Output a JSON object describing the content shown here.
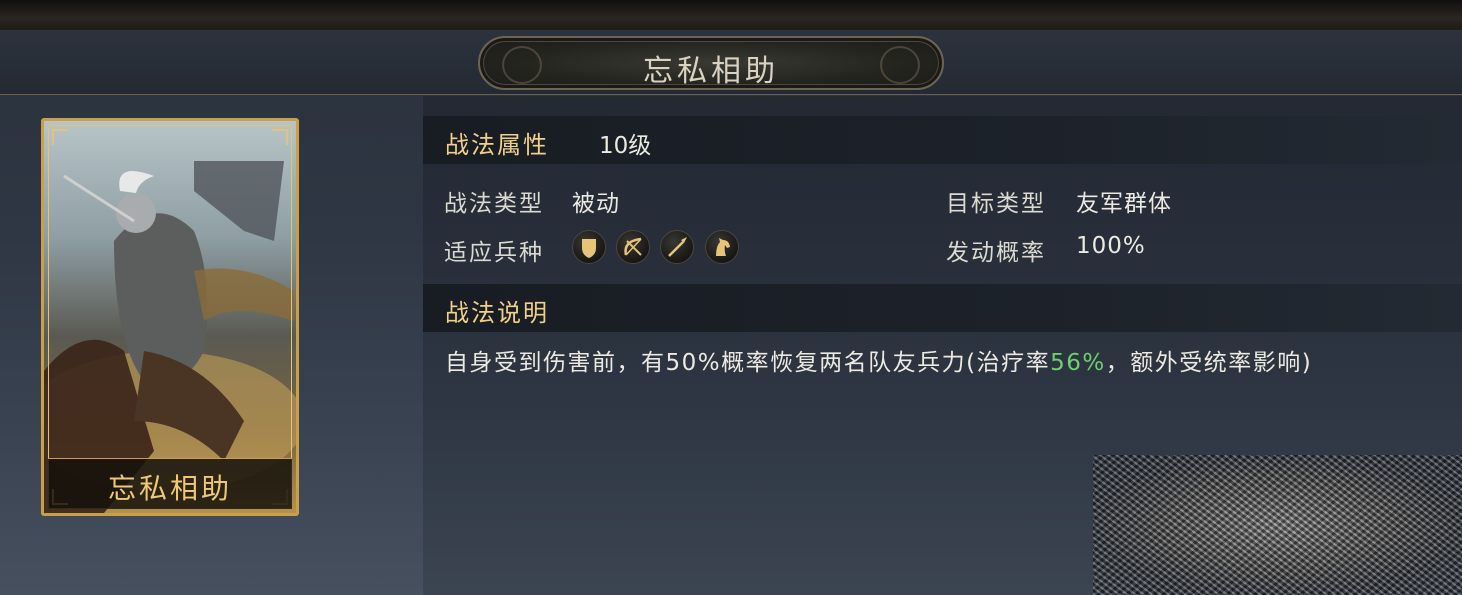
{
  "header": {
    "title": "忘私相助"
  },
  "card": {
    "name": "忘私相助"
  },
  "attributes": {
    "title": "战法属性",
    "level": "10级",
    "type_label": "战法类型",
    "type_value": "被动",
    "target_label": "目标类型",
    "target_value": "友军群体",
    "troops_label": "适应兵种",
    "troops": [
      "shield-icon",
      "bow-icon",
      "spear-icon",
      "horse-icon"
    ],
    "trigger_label": "发动概率",
    "trigger_value": "100%"
  },
  "description": {
    "title": "战法说明",
    "text_before": "自身受到伤害前，有50%概率恢复两名队友兵力(治疗率",
    "heal_rate": "56%",
    "text_after": "，额外受统率影响)",
    "highlight_color": "#6fce71"
  }
}
